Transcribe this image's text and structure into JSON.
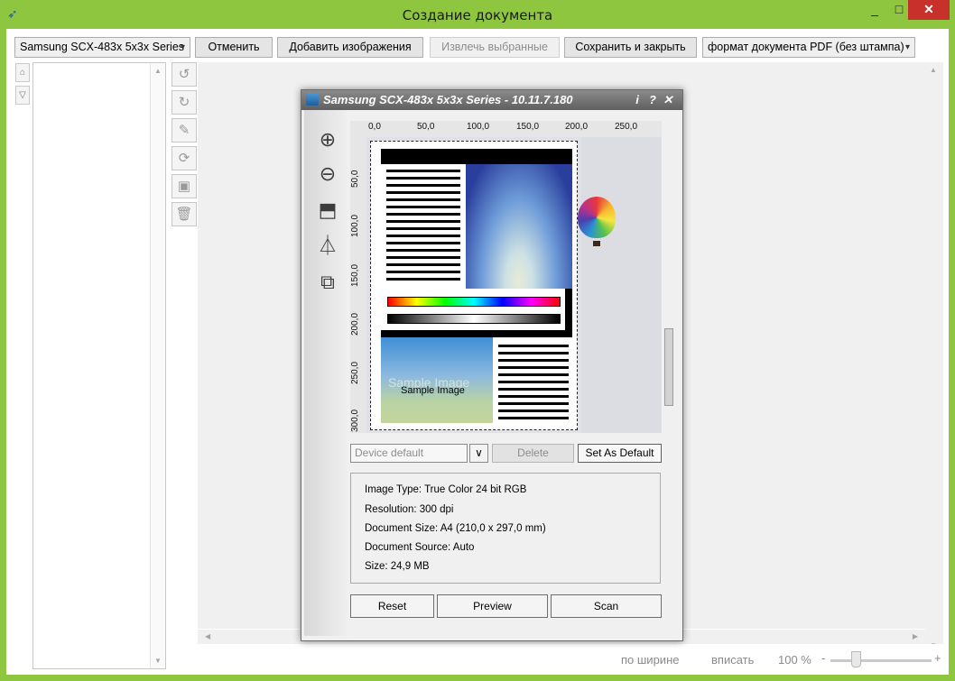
{
  "window": {
    "title": "Создание документа",
    "minimize": "_",
    "maximize": "□",
    "close": "✕"
  },
  "toolbar": {
    "printer": "Samsung SCX-483x 5x3x Series",
    "cancel": "Отменить",
    "add_images": "Добавить изображения",
    "extract_selected": "Извлечь выбранные",
    "save_close": "Сохранить и закрыть",
    "format": "формат документа PDF  (без штампа)"
  },
  "status": {
    "fit_width": "по ширине",
    "fit": "вписать",
    "zoom": "100 %",
    "minus": "-",
    "plus": "+",
    "zoom_level": 0.34
  },
  "dialog": {
    "title": "Samsung SCX-483x 5x3x Series - 10.11.7.180",
    "help": "?",
    "info_btn": "i",
    "ruler_top": [
      "0,0",
      "50,0",
      "100,0",
      "150,0",
      "200,0",
      "250,0"
    ],
    "ruler_left": [
      "50,0",
      "100,0",
      "150,0",
      "200,0",
      "250,0",
      "300,0"
    ],
    "preview_watermark": "Sample Image",
    "preview_label": "Sample Image",
    "preset": "Device default",
    "delete": "Delete",
    "set_default": "Set As Default",
    "info": {
      "image_type": "Image Type: True Color 24 bit RGB",
      "resolution": "Resolution: 300 dpi",
      "doc_size": "Document Size: A4 (210,0 x 297,0 mm)",
      "doc_source": "Document Source: Auto",
      "size": "Size: 24,9 MB"
    },
    "reset": "Reset",
    "preview": "Preview",
    "scan": "Scan"
  }
}
